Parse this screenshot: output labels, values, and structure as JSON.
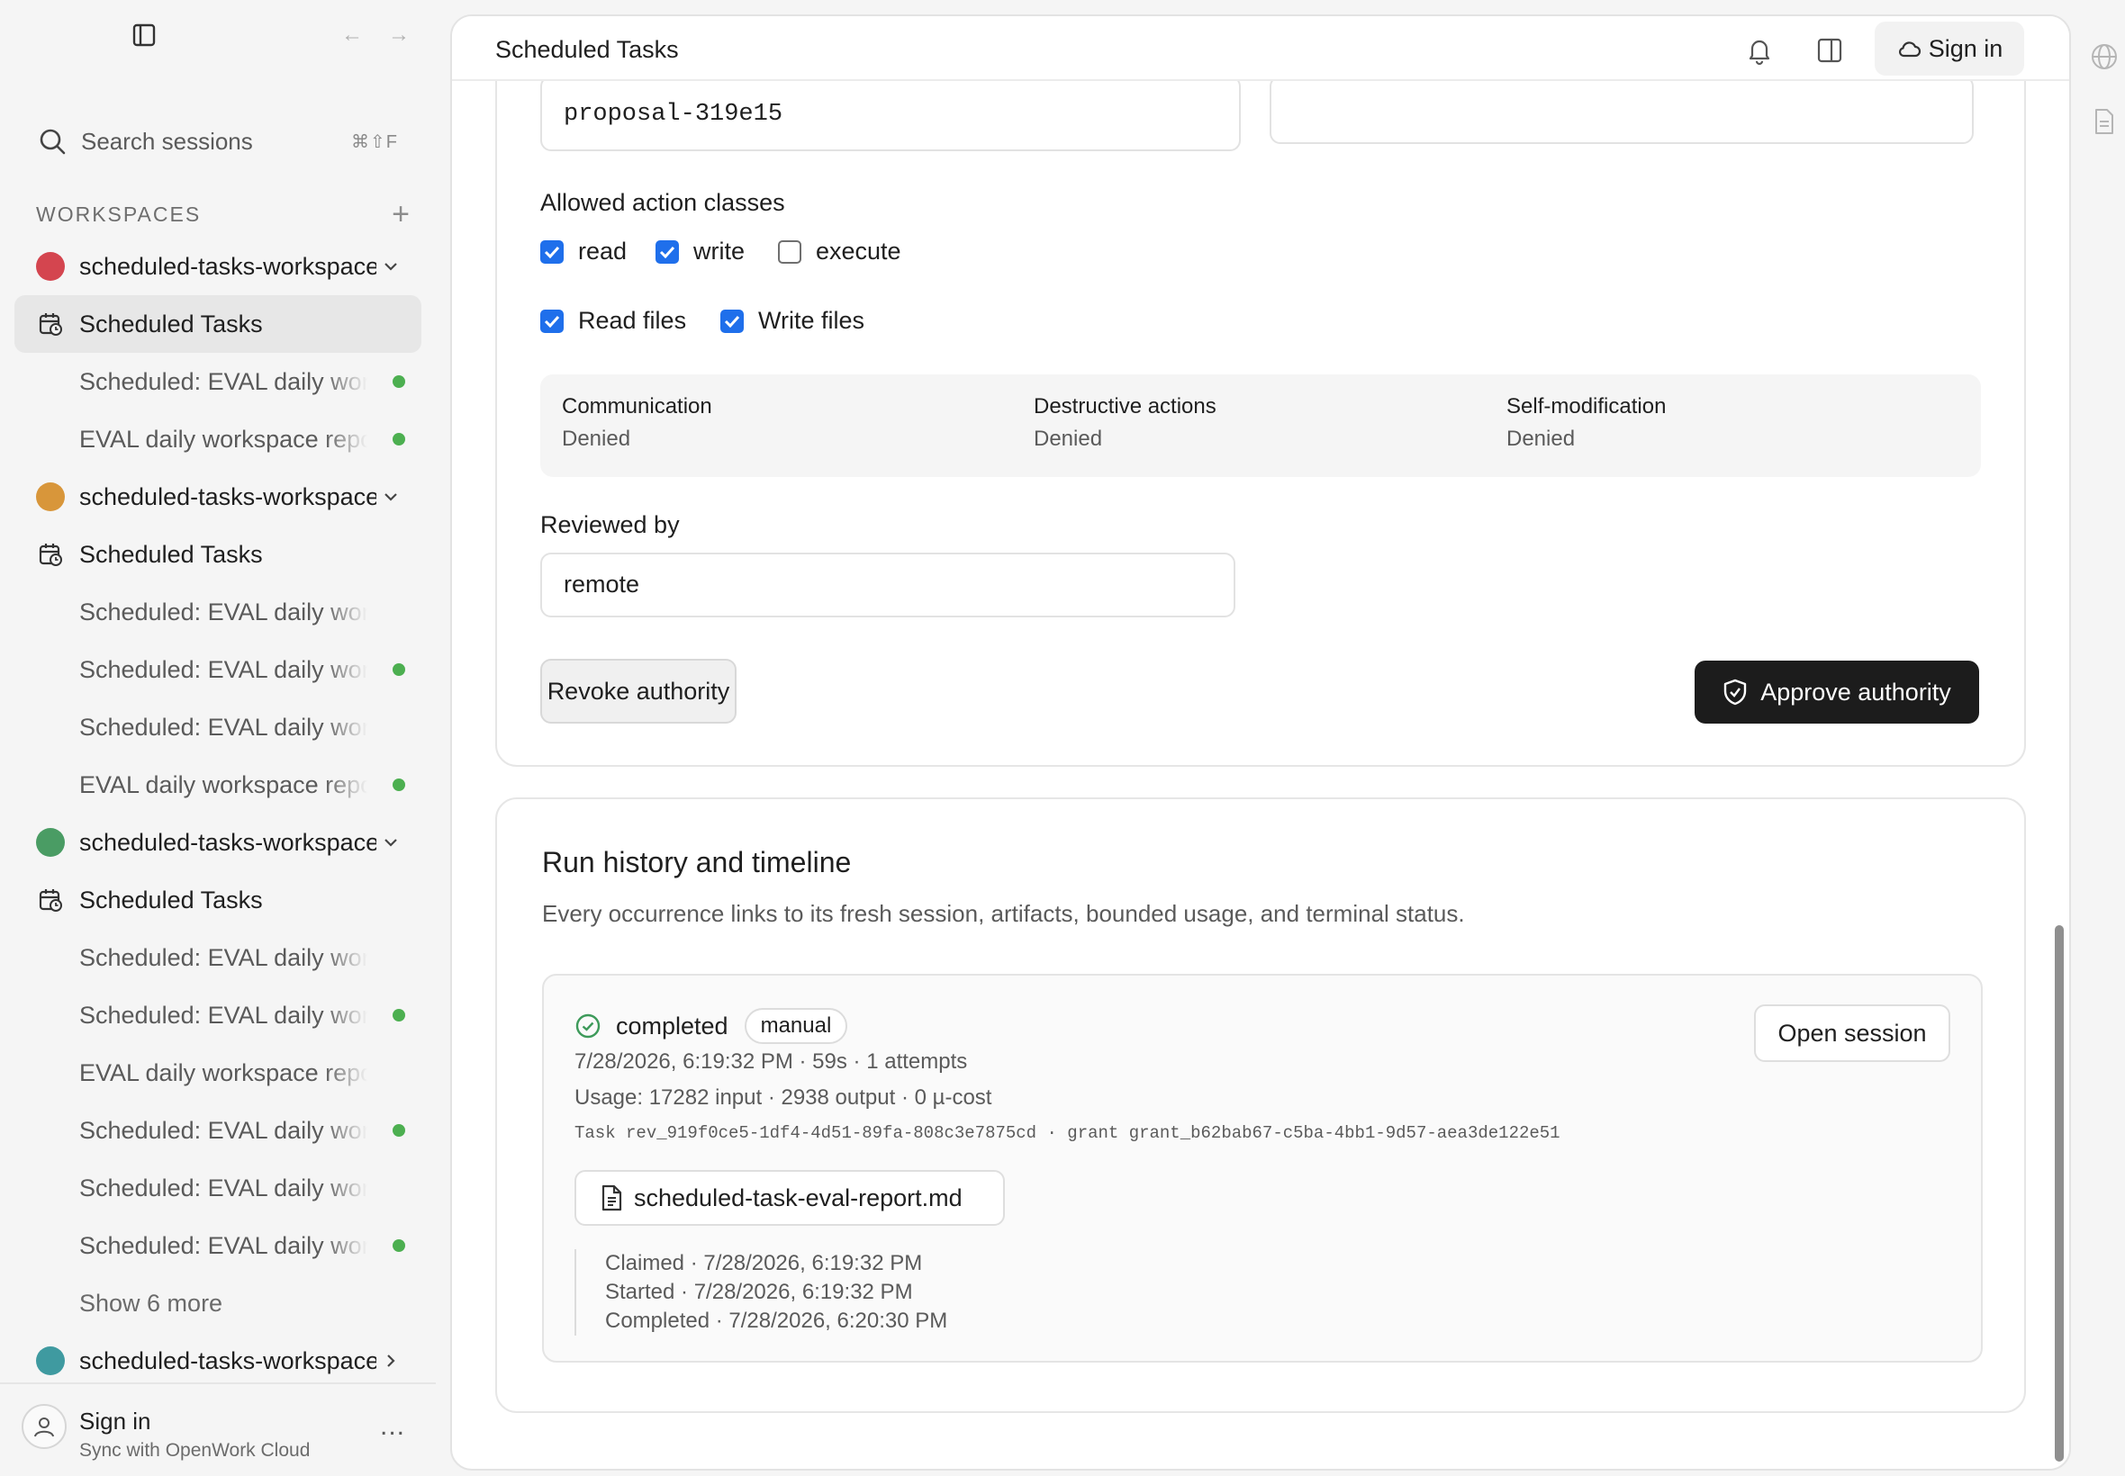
{
  "sidebar": {
    "search": {
      "label": "Search sessions",
      "shortcut": "⌘⇧F"
    },
    "workspaces_header": "WORKSPACES",
    "rows": [
      {
        "kind": "workspace",
        "name": "scheduled-tasks-workspace",
        "color": "#d4454f",
        "expanded": true
      },
      {
        "kind": "tasks",
        "name": "Scheduled Tasks",
        "active": true
      },
      {
        "kind": "session",
        "name": "Scheduled: EVAL daily workspace report",
        "dot": true
      },
      {
        "kind": "session",
        "name": "EVAL daily workspace report",
        "dot": true
      },
      {
        "kind": "workspace",
        "name": "scheduled-tasks-workspace",
        "color": "#d8963a",
        "expanded": true
      },
      {
        "kind": "tasks",
        "name": "Scheduled Tasks"
      },
      {
        "kind": "session",
        "name": "Scheduled: EVAL daily workspace report",
        "dot": false
      },
      {
        "kind": "session",
        "name": "Scheduled: EVAL daily workspace report",
        "dot": true
      },
      {
        "kind": "session",
        "name": "Scheduled: EVAL daily workspace report",
        "dot": false
      },
      {
        "kind": "session",
        "name": "EVAL daily workspace report",
        "dot": true
      },
      {
        "kind": "workspace",
        "name": "scheduled-tasks-workspace",
        "color": "#4a9c64",
        "expanded": true
      },
      {
        "kind": "tasks",
        "name": "Scheduled Tasks"
      },
      {
        "kind": "session",
        "name": "Scheduled: EVAL daily workspace report",
        "dot": false
      },
      {
        "kind": "session",
        "name": "Scheduled: EVAL daily workspace report",
        "dot": true
      },
      {
        "kind": "session",
        "name": "EVAL daily workspace report",
        "dot": false
      },
      {
        "kind": "session",
        "name": "Scheduled: EVAL daily workspace report",
        "dot": true
      },
      {
        "kind": "session",
        "name": "Scheduled: EVAL daily workspace report",
        "dot": false
      },
      {
        "kind": "session",
        "name": "Scheduled: EVAL daily workspace report",
        "dot": true
      },
      {
        "kind": "more",
        "name": "Show 6 more"
      },
      {
        "kind": "workspace",
        "name": "scheduled-tasks-workspace",
        "color": "#3f9aa0",
        "expanded": false
      }
    ],
    "footer": {
      "title": "Sign in",
      "subtitle": "Sync with OpenWork Cloud",
      "more": "..."
    }
  },
  "header": {
    "title": "Scheduled Tasks",
    "sign_in": "Sign in"
  },
  "authority": {
    "proposal_value": "proposal-319e15",
    "allowed_label": "Allowed action classes",
    "classes": [
      {
        "label": "read",
        "checked": true
      },
      {
        "label": "write",
        "checked": true
      },
      {
        "label": "execute",
        "checked": false
      }
    ],
    "files": [
      {
        "label": "Read files",
        "checked": true
      },
      {
        "label": "Write files",
        "checked": true
      }
    ],
    "denied": [
      {
        "key": "Communication",
        "value": "Denied"
      },
      {
        "key": "Destructive actions",
        "value": "Denied"
      },
      {
        "key": "Self-modification",
        "value": "Denied"
      }
    ],
    "reviewed_label": "Reviewed by",
    "reviewed_value": "remote",
    "revoke_label": "Revoke authority",
    "approve_label": "Approve authority"
  },
  "history": {
    "title": "Run history and timeline",
    "description": "Every occurrence links to its fresh session, artifacts, bounded usage, and terminal status.",
    "run": {
      "status": "completed",
      "trigger": "manual",
      "open_label": "Open session",
      "summary": "7/28/2026, 6:19:32 PM · 59s · 1 attempts",
      "usage": "Usage: 17282 input · 2938 output · 0 µ-cost",
      "ids": "Task rev_919f0ce5-1df4-4d51-89fa-808c3e7875cd · grant grant_b62bab67-c5ba-4bb1-9d57-aea3de122e51",
      "artifact": "scheduled-task-eval-report.md",
      "timeline": [
        "Claimed · 7/28/2026, 6:19:32 PM",
        "Started · 7/28/2026, 6:19:32 PM",
        "Completed · 7/28/2026, 6:20:30 PM"
      ]
    }
  }
}
